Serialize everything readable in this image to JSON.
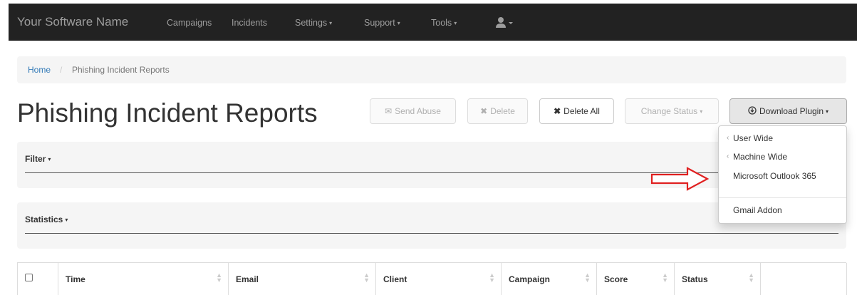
{
  "navbar": {
    "brand": "Your Software Name",
    "items": [
      {
        "label": "Campaigns",
        "caret": false
      },
      {
        "label": "Incidents",
        "caret": false
      },
      {
        "label": "Settings",
        "caret": true
      },
      {
        "label": "Support",
        "caret": true
      },
      {
        "label": "Tools",
        "caret": true
      }
    ],
    "user_icon": "user-icon",
    "caret_glyph": "▾"
  },
  "breadcrumb": {
    "home": "Home",
    "separator": "/",
    "current": "Phishing Incident Reports"
  },
  "page_title": "Phishing Incident Reports",
  "toolbar": {
    "send_abuse": {
      "label": "Send Abuse",
      "icon": "envelope-icon"
    },
    "delete": {
      "label": "Delete",
      "icon": "times-icon"
    },
    "delete_all": {
      "label": "Delete All",
      "icon": "times-icon"
    },
    "change_status": {
      "label": "Change Status"
    },
    "download_plugin": {
      "label": "Download Plugin",
      "icon": "download-circle-icon"
    }
  },
  "download_menu": {
    "items": [
      "User Wide",
      "Machine Wide",
      "Microsoft Outlook 365",
      "Gmail Addon"
    ]
  },
  "panels": {
    "filter": "Filter",
    "statistics": "Statistics"
  },
  "table": {
    "columns": [
      "Time",
      "Email",
      "Client",
      "Campaign",
      "Score",
      "Status"
    ]
  },
  "colors": {
    "navbar_bg": "#222222",
    "link": "#337ab7",
    "annotation_arrow": "#e02020"
  }
}
